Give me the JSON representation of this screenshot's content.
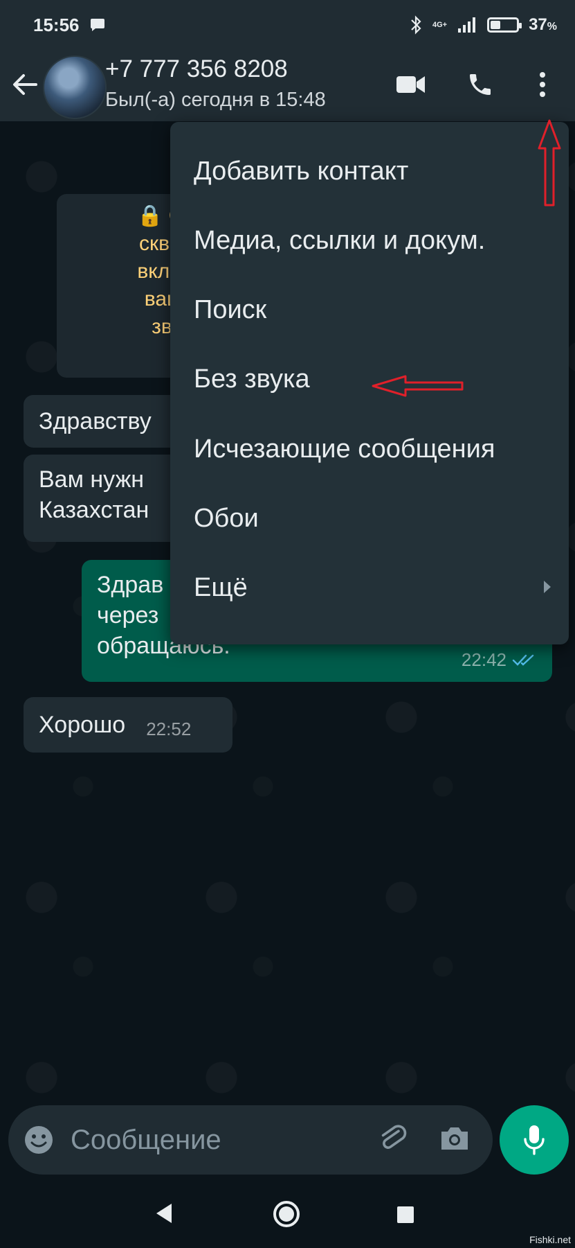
{
  "status_bar": {
    "time": "15:56",
    "network": "4G+",
    "battery": "37",
    "battery_unit": "%"
  },
  "header": {
    "contact_name": "+7 777 356 8208",
    "contact_status": "Был(-а) сегодня в 15:48"
  },
  "encryption_notice": {
    "lines": [
      "🔒 Сооб",
      "сквозны",
      "включая",
      "ваши с",
      "звонк"
    ]
  },
  "messages": [
    {
      "direction": "in",
      "lines": [
        "Здравству"
      ]
    },
    {
      "direction": "in",
      "lines": [
        "Вам нужн",
        "Казахстан"
      ]
    },
    {
      "direction": "out",
      "lines": [
        "Здрав",
        "через",
        "обращаюсь."
      ],
      "time": "22:42"
    },
    {
      "direction": "in",
      "lines": [
        "Хорошо"
      ],
      "time": "22:52"
    }
  ],
  "menu": {
    "items": [
      "Добавить контакт",
      "Медиа, ссылки и докум.",
      "Поиск",
      "Без звука",
      "Исчезающие сообщения",
      "Обои",
      "Ещё"
    ]
  },
  "input": {
    "placeholder": "Сообщение"
  },
  "watermark": "Fishki.net",
  "colors": {
    "accent": "#00a884",
    "outgoing_bubble": "#005c4b",
    "incoming_bubble": "#202c33",
    "annotation": "#e0202a"
  },
  "icons": [
    "back-arrow-icon",
    "video-call-icon",
    "phone-icon",
    "more-vert-icon",
    "emoji-icon",
    "attach-icon",
    "camera-icon",
    "mic-icon",
    "chevron-right-icon",
    "double-check-icon"
  ]
}
